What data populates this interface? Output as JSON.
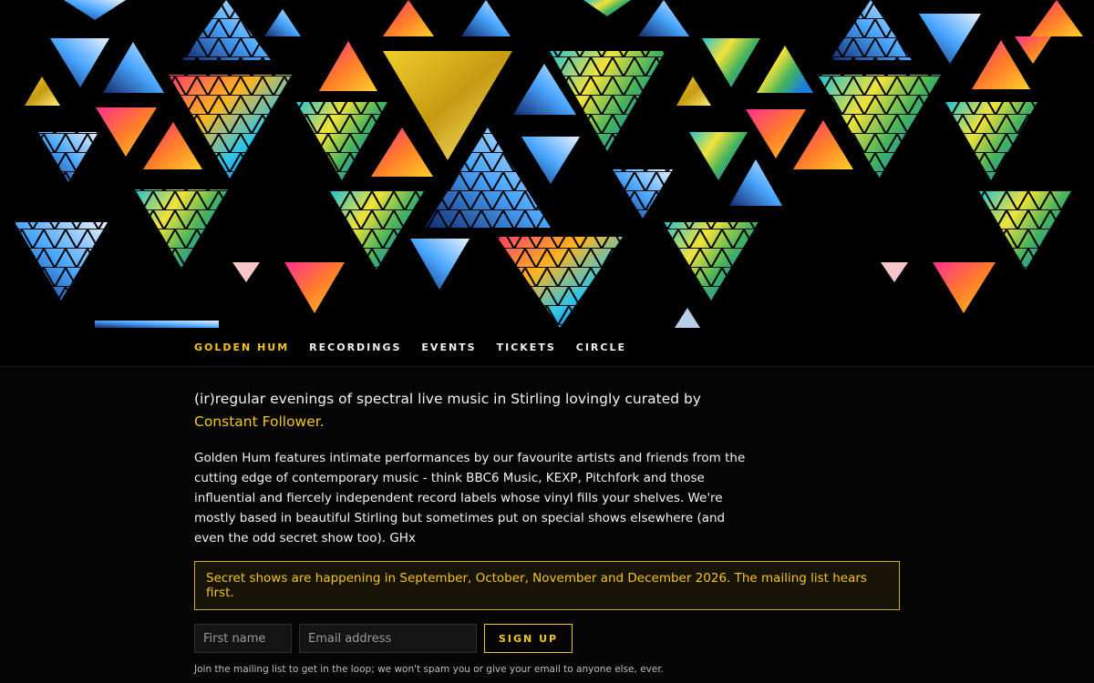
{
  "nav": {
    "items": [
      {
        "label": "GOLDEN HUM",
        "active": true
      },
      {
        "label": "RECORDINGS"
      },
      {
        "label": "EVENTS"
      },
      {
        "label": "TICKETS"
      },
      {
        "label": "CIRCLE"
      }
    ]
  },
  "intro": {
    "text": "(ir)regular evenings of spectral live music in Stirling lovingly curated by ",
    "link": "Constant Follower."
  },
  "description": "Golden Hum features intimate performances by our favourite artists and friends from the cutting edge of contemporary music - think BBC6 Music, KEXP, Pitchfork and those influential and fiercely independent record labels whose vinyl fills your shelves. We're mostly based in beautiful Stirling but sometimes put on special shows elsewhere (and even the odd secret show too). GHx",
  "notice": "Secret shows are happening in September, October, November and December 2026. The mailing list hears first.",
  "signup": {
    "first_placeholder": "First name",
    "email_placeholder": "Email address",
    "button": "SIGN UP",
    "note": "Join the mailing list to get in the loop; we won't spam you or give your email to anyone else, ever."
  },
  "colors": {
    "accent": "#f5c518",
    "background": "#050505"
  }
}
